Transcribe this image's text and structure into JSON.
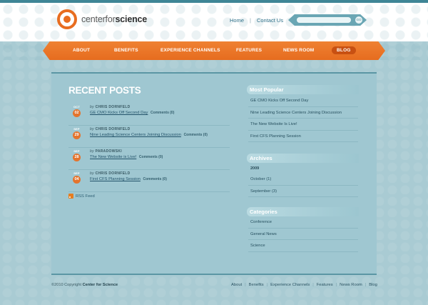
{
  "header": {
    "logo_prefix": "center",
    "logo_mid": "for",
    "logo_suffix": "science",
    "links": [
      "Home",
      "Contact Us"
    ],
    "search": {
      "placeholder": "",
      "button": "GO"
    }
  },
  "nav": {
    "items": [
      "ABOUT",
      "BENEFITS",
      "EXPERIENCE CHANNELS",
      "FEATURES",
      "NEWS ROOM",
      "BLOG"
    ],
    "active": "BLOG"
  },
  "recent": {
    "title": "RECENT POSTS",
    "posts": [
      {
        "month": "OCT",
        "day": "02",
        "author_prefix": "by",
        "author": "CHRIS DORNFELD",
        "title": "GE CMO Kicks Off Second Day",
        "comments": "Comments (0)"
      },
      {
        "month": "SEP",
        "day": "29",
        "author_prefix": "by",
        "author": "CHRIS DORNFELD",
        "title": "Nine Leading Science Centers Joining Discussion",
        "comments": "Comments (0)"
      },
      {
        "month": "SEP",
        "day": "28",
        "author_prefix": "by",
        "author": "PARADOWSKI",
        "title": "The New Website is Live!",
        "comments": "Comments (0)"
      },
      {
        "month": "SEP",
        "day": "04",
        "author_prefix": "by",
        "author": "CHRIS DORNFELD",
        "title": "First CFS Planning Session",
        "comments": "Comments (0)"
      }
    ],
    "rss": "RSS Feed"
  },
  "sidebar": {
    "popular_title": "Most Popular",
    "popular": [
      "GE CMO Kicks Off Second Day",
      "Nine Leading Science Centers Joining Discussion",
      "The New Website Is Live!",
      "First CFS Planning Session"
    ],
    "archives_title": "Archives",
    "archive_year": "2009",
    "archives": [
      "October (1)",
      "September (3)"
    ],
    "categories_title": "Categories",
    "categories": [
      "Conference",
      "General News",
      "Science"
    ]
  },
  "footer": {
    "copyright_prefix": "©2010 Copyright",
    "copyright_name": "Center for Science",
    "links": [
      "About",
      "Benefits",
      "Experience Channels",
      "Features",
      "News Room",
      "Blog"
    ]
  },
  "colors": {
    "accent": "#e86d20",
    "teal": "#3f8696",
    "background": "#a9cbd3"
  }
}
